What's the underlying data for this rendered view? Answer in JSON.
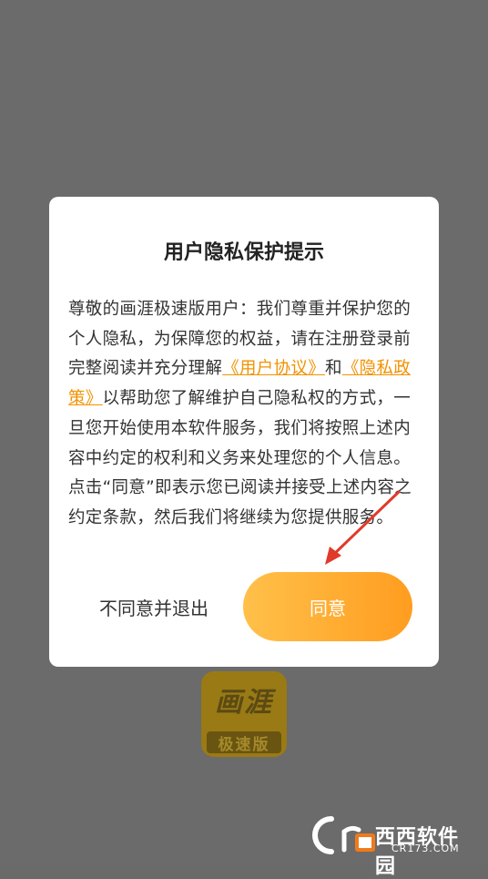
{
  "dialog": {
    "title": "用户隐私保护提示",
    "body_part1": "尊敬的画涯极速版用户：我们尊重并保护您的个人隐私，为保障您的权益，请在注册登录前完整阅读并充分理解",
    "link_user_agreement": "《用户协议》",
    "body_and": "和",
    "link_privacy_policy": "《隐私政策》",
    "body_part2": "以帮助您了解维护自己隐私权的方式，一旦您开始使用本软件服务，我们将按照上述内容中约定的权利和义务来处理您的个人信息。点击“同意”即表示您已阅读并接受上述内容之约定条款，然后我们将继续为您提供服务。",
    "decline_label": "不同意并退出",
    "agree_label": "同意"
  },
  "app_logo": {
    "line1": "画涯",
    "line2": "极速版"
  },
  "watermark": {
    "text": "西西软件园",
    "sub": "CR173.COM"
  },
  "colors": {
    "accent": "#f29200",
    "button_gradient_start": "#ffc04a",
    "button_gradient_end": "#ff9d1f",
    "annotation": "#e03a2a"
  }
}
